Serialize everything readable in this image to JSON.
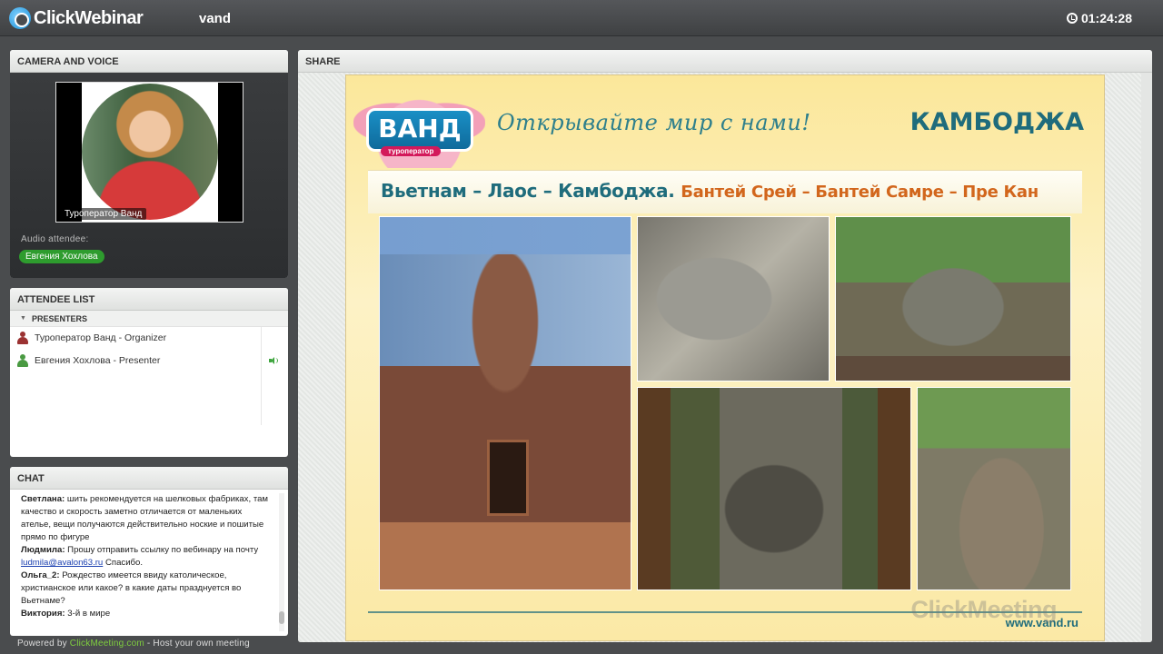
{
  "app": {
    "brand": "ClickWebinar",
    "room": "vand",
    "timer": "01:24:28"
  },
  "camera": {
    "header": "CAMERA AND VOICE",
    "video_caption": "Туроператор Ванд",
    "audio_label": "Audio attendee:",
    "audio_attendee": "Евгения Хохлова"
  },
  "attendees": {
    "header": "ATTENDEE LIST",
    "section": "PRESENTERS",
    "items": [
      {
        "label": "Туроператор Ванд - Organizer",
        "role": "organizer"
      },
      {
        "label": "Евгения Хохлова - Presenter",
        "role": "presenter"
      }
    ]
  },
  "chat": {
    "header": "CHAT",
    "messages": [
      {
        "author": "Светлана:",
        "text": " шить рекомендуется на шелковых фабриках, там качество и скорость заметно отличается от маленьких ателье, вещи получаются действительно ноские и пошитые прямо по фигуре"
      },
      {
        "author": "Людмила:",
        "text": " Прошу отправить ссылку по вебинару на почту ",
        "link": "ludmila@avalon63.ru",
        "after": "  Спасибо."
      },
      {
        "author": "Ольга_2:",
        "text": " Рождество имеется ввиду католическое, христианское или какое? в какие даты празднуется во Вьетнаме?"
      },
      {
        "author": "Виктория:",
        "text": " 3-й в мире"
      }
    ]
  },
  "footer": {
    "prefix": "Powered by ",
    "brand": "ClickMeeting.com",
    "suffix": " - Host your own meeting"
  },
  "share": {
    "header": "SHARE",
    "slide": {
      "logo_text": "ВАНД",
      "logo_sub": "туроператор",
      "slogan": "Открывайте мир с нами!",
      "country": "КАМБОДЖА",
      "route_main": "Вьетнам – Лаос – Камбоджа.",
      "route_sub": "Бантей Срей – Бантей Самре – Пре Кан",
      "url": "www.vand.ru",
      "watermark": "ClickMeeting"
    }
  },
  "colors": {
    "accent_green": "#2e9c2e",
    "slide_teal": "#1f6c7c",
    "slide_orange": "#d2661c",
    "link_blue": "#1a3fb0"
  },
  "icons": [
    "clock-icon",
    "person-icon",
    "speaker-icon",
    "collapse-triangle-icon"
  ]
}
